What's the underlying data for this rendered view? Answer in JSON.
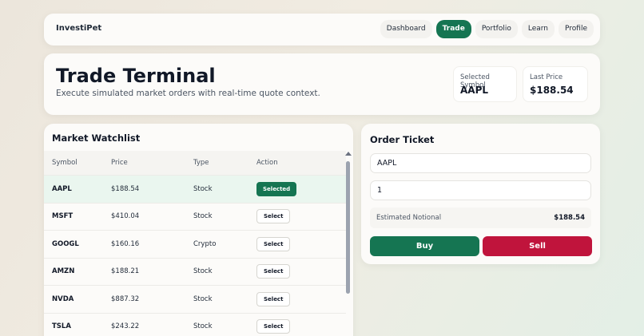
{
  "nav": {
    "brand": "InvestiPet",
    "links": [
      "Dashboard",
      "Trade",
      "Portfolio",
      "Learn",
      "Profile"
    ],
    "active": "Trade"
  },
  "header": {
    "title": "Trade Terminal",
    "subtitle": "Execute simulated market orders with real-time quote context.",
    "selected_symbol_label": "Selected Symbol",
    "selected_symbol": "AAPL",
    "last_price_label": "Last Price",
    "last_price": "$188.54"
  },
  "watchlist": {
    "title": "Market Watchlist",
    "columns": [
      "Symbol",
      "Price",
      "Type",
      "Action"
    ],
    "rows": [
      {
        "symbol": "AAPL",
        "price": "$188.54",
        "type": "Stock",
        "action": "Selected"
      },
      {
        "symbol": "MSFT",
        "price": "$410.04",
        "type": "Stock",
        "action": "Select"
      },
      {
        "symbol": "GOOGL",
        "price": "$160.16",
        "type": "Crypto",
        "action": "Select"
      },
      {
        "symbol": "AMZN",
        "price": "$188.21",
        "type": "Stock",
        "action": "Select"
      },
      {
        "symbol": "NVDA",
        "price": "$887.32",
        "type": "Stock",
        "action": "Select"
      },
      {
        "symbol": "TSLA",
        "price": "$243.22",
        "type": "Stock",
        "action": "Select"
      }
    ]
  },
  "ticket": {
    "title": "Order Ticket",
    "symbol_value": "AAPL",
    "quantity_value": "1",
    "notional_label": "Estimated Notional",
    "notional_value": "$188.54",
    "buy_label": "Buy",
    "sell_label": "Sell"
  },
  "colors": {
    "accent": "#157552",
    "danger": "#c0143c"
  }
}
